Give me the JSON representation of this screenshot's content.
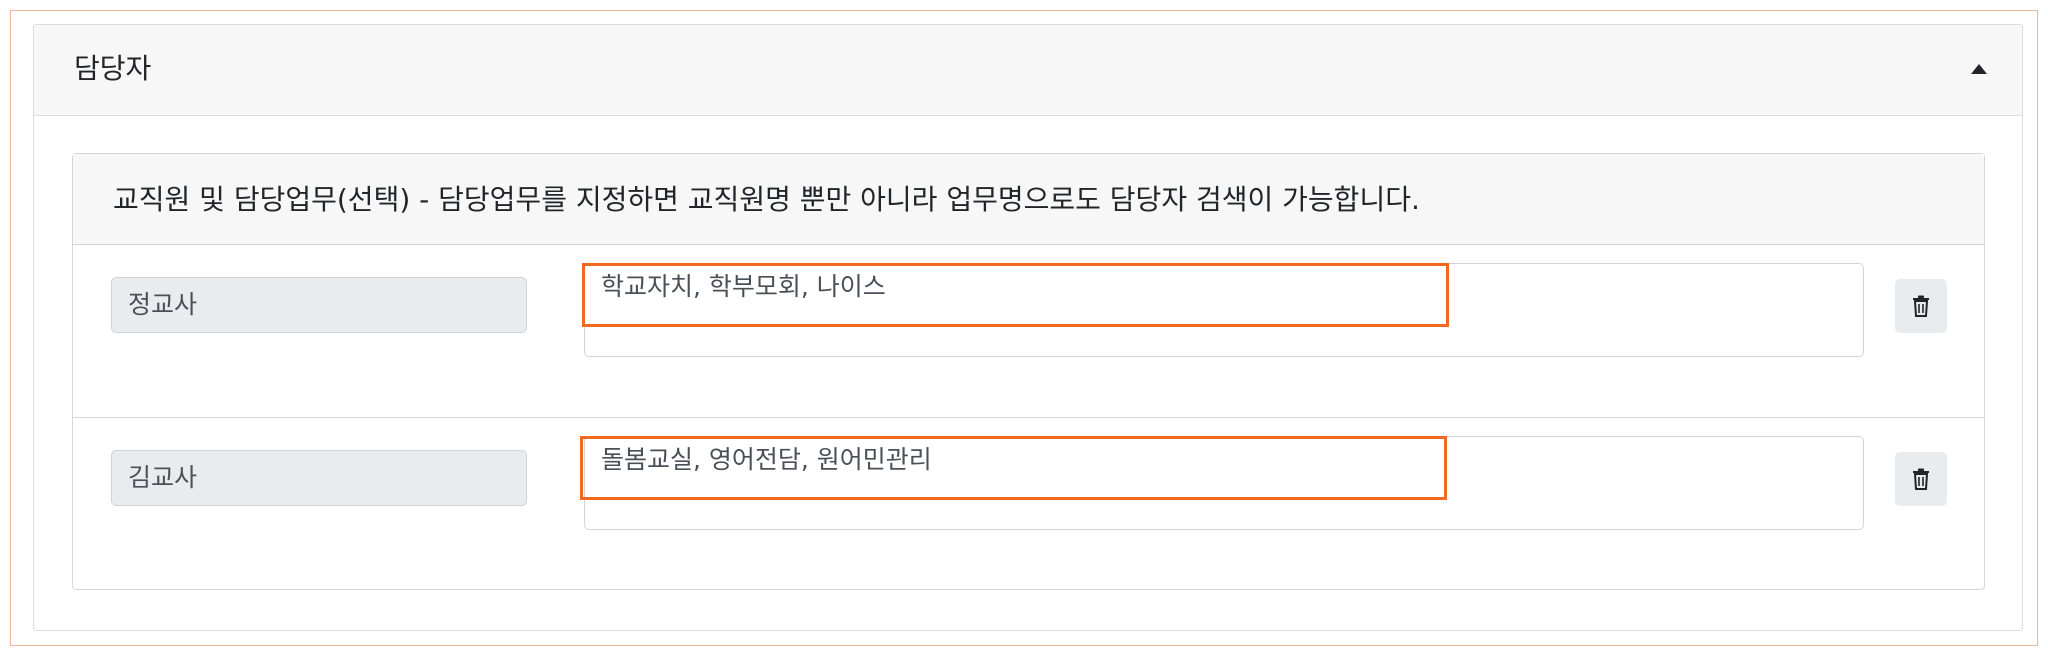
{
  "panel": {
    "title": "담당자",
    "collapse_icon": "caret-up-icon",
    "section": {
      "description": "교직원 및 담당업무(선택) - 담당업무를 지정하면 교직원명 뿐만 아니라 업무명으로도 담당자 검색이 가능합니다.",
      "rows": [
        {
          "name": "정교사",
          "duties": "학교자치, 학부모회, 나이스",
          "delete_icon": "trash-icon"
        },
        {
          "name": "김교사",
          "duties": "돌봄교실, 영어전담, 원어민관리",
          "delete_icon": "trash-icon"
        }
      ]
    }
  },
  "colors": {
    "highlight": "#f06a22",
    "header_bg": "#f7f7f7",
    "readonly_bg": "#e9ecef"
  }
}
